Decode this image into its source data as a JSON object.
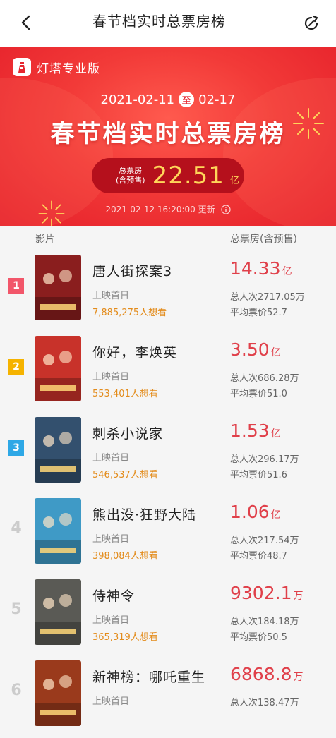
{
  "header": {
    "title": "春节档实时总票房榜",
    "back_icon": "chevron-left-icon",
    "share_icon": "refresh-icon"
  },
  "banner": {
    "brand": "灯塔专业版",
    "date_start": "2021-02-11",
    "date_sep": "至",
    "date_end": "02-17",
    "headline": "春节档实时总票房榜",
    "total_label_1": "总票房",
    "total_label_2": "(含预售)",
    "total_value": "22.51",
    "total_unit": "亿",
    "updated": "2021-02-12 16:20:00 更新",
    "colors": {
      "bg": "#f23a38",
      "accent": "#ffd65a",
      "pill": "#b5101c"
    }
  },
  "columns": {
    "film": "影片",
    "gross": "总票房(含预售)"
  },
  "movies": [
    {
      "rank": "1",
      "title": "唐人街探案3",
      "release": "上映首日",
      "want": "7,885,275人想看",
      "gross": "14.33",
      "unit": "亿",
      "viewers": "总人次2717.05万",
      "avg": "平均票价52.7",
      "poster_color": "#8a1e1e"
    },
    {
      "rank": "2",
      "title": "你好，李焕英",
      "release": "上映首日",
      "want": "553,401人想看",
      "gross": "3.50",
      "unit": "亿",
      "viewers": "总人次686.28万",
      "avg": "平均票价51.0",
      "poster_color": "#c8322a"
    },
    {
      "rank": "3",
      "title": "刺杀小说家",
      "release": "上映首日",
      "want": "546,537人想看",
      "gross": "1.53",
      "unit": "亿",
      "viewers": "总人次296.17万",
      "avg": "平均票价51.6",
      "poster_color": "#33506e"
    },
    {
      "rank": "4",
      "title": "熊出没·狂野大陆",
      "release": "上映首日",
      "want": "398,084人想看",
      "gross": "1.06",
      "unit": "亿",
      "viewers": "总人次217.54万",
      "avg": "平均票价48.7",
      "poster_color": "#3f9ac6"
    },
    {
      "rank": "5",
      "title": "侍神令",
      "release": "上映首日",
      "want": "365,319人想看",
      "gross": "9302.1",
      "unit": "万",
      "viewers": "总人次184.18万",
      "avg": "平均票价50.5",
      "poster_color": "#5a5a55"
    },
    {
      "rank": "6",
      "title": "新神榜：哪吒重生",
      "release": "上映首日",
      "want": "",
      "gross": "6868.8",
      "unit": "万",
      "viewers": "总人次138.47万",
      "avg": "",
      "poster_color": "#9a3a1c"
    }
  ]
}
